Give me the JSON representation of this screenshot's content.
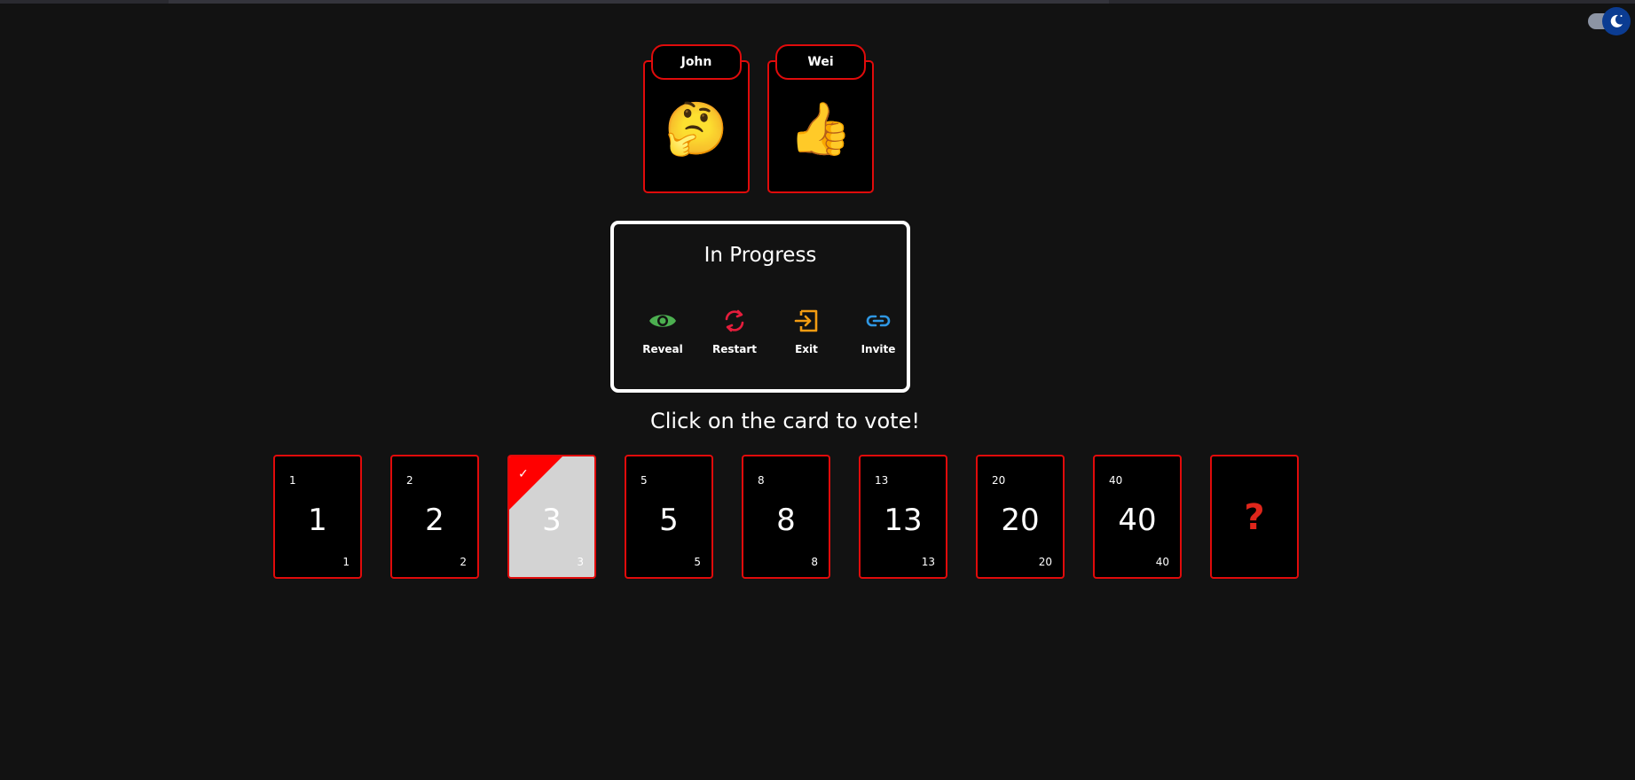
{
  "theme_toggle": {
    "icon": "moon-icon"
  },
  "players": [
    {
      "name": "John",
      "status_emoji": "🤔"
    },
    {
      "name": "Wei",
      "status_emoji": "👍"
    }
  ],
  "status": {
    "title": "In Progress",
    "actions": [
      {
        "label": "Reveal",
        "icon": "eye-icon",
        "color": "#4caf50"
      },
      {
        "label": "Restart",
        "icon": "refresh-icon",
        "color": "#e51d3c"
      },
      {
        "label": "Exit",
        "icon": "exit-icon",
        "color": "#f39c12"
      },
      {
        "label": "Invite",
        "icon": "link-icon",
        "color": "#2f97e3"
      }
    ]
  },
  "prompt": "Click on the card to vote!",
  "cards": [
    {
      "value": "1"
    },
    {
      "value": "2"
    },
    {
      "value": "3",
      "selected": true,
      "check": "✓"
    },
    {
      "value": "5"
    },
    {
      "value": "8"
    },
    {
      "value": "13"
    },
    {
      "value": "20"
    },
    {
      "value": "40"
    },
    {
      "value": "?"
    }
  ],
  "colors": {
    "background": "#121212",
    "card_border": "#e00b0b",
    "selected_card": "#d3d3d3"
  }
}
